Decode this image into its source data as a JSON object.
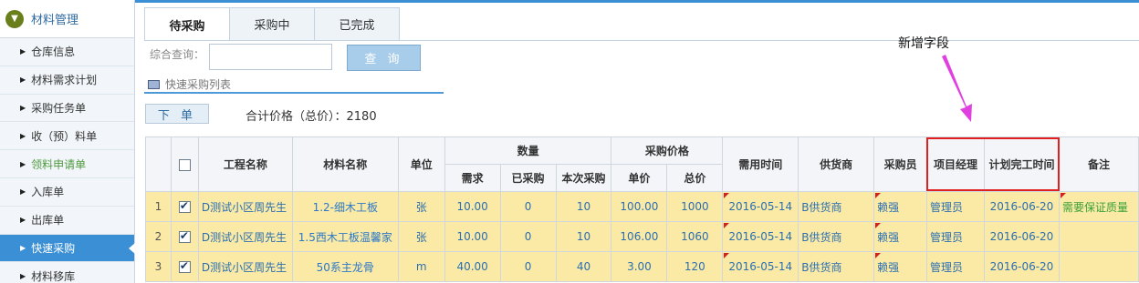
{
  "sidebar": {
    "header": "材料管理",
    "items": [
      {
        "label": "仓库信息",
        "state": "normal"
      },
      {
        "label": "材料需求计划",
        "state": "normal"
      },
      {
        "label": "采购任务单",
        "state": "normal"
      },
      {
        "label": "收（预）料单",
        "state": "normal"
      },
      {
        "label": "领料申请单",
        "state": "green"
      },
      {
        "label": "入库单",
        "state": "normal"
      },
      {
        "label": "出库单",
        "state": "normal"
      },
      {
        "label": "快速采购",
        "state": "active"
      },
      {
        "label": "材料移库",
        "state": "normal"
      }
    ]
  },
  "tabs": [
    "待采购",
    "采购中",
    "已完成"
  ],
  "search": {
    "label": "综合查询：",
    "value": "",
    "button": "查 询"
  },
  "list_title": "快速采购列表",
  "order_button": "下 单",
  "total_text": "合计价格（总价）：2180",
  "annotation": {
    "text": "新增字段",
    "color": "#e040e0",
    "box_color": "#e02020"
  },
  "table": {
    "headers": {
      "project": "工程名称",
      "material": "材料名称",
      "unit": "单位",
      "quantity_group": "数量",
      "qty_demand": "需求",
      "qty_bought": "已采购",
      "qty_this": "本次采购",
      "price_group": "采购价格",
      "unit_price": "单价",
      "total_price": "总价",
      "need_time": "需用时间",
      "supplier": "供货商",
      "buyer": "采购员",
      "pm": "项目经理",
      "plan_finish": "计划完工时间",
      "remark": "备注"
    },
    "rows": [
      {
        "idx": "1",
        "checked": true,
        "project": "D测试小区周先生",
        "material": "1.2-细木工板",
        "unit": "张",
        "demand": "10.00",
        "bought": "0",
        "this": "10",
        "price": "100.00",
        "total": "1000",
        "need_time": "2016-05-14",
        "supplier": "B供货商",
        "buyer": "赖强",
        "pm": "管理员",
        "plan": "2016-06-20",
        "remark": "需要保证质量"
      },
      {
        "idx": "2",
        "checked": true,
        "project": "D测试小区周先生",
        "material": "1.5西木工板温馨家",
        "unit": "张",
        "demand": "10.00",
        "bought": "0",
        "this": "10",
        "price": "106.00",
        "total": "1060",
        "need_time": "2016-05-14",
        "supplier": "B供货商",
        "buyer": "赖强",
        "pm": "管理员",
        "plan": "2016-06-20",
        "remark": ""
      },
      {
        "idx": "3",
        "checked": true,
        "project": "D测试小区周先生",
        "material": "50系主龙骨",
        "unit": "m",
        "demand": "40.00",
        "bought": "0",
        "this": "40",
        "price": "3.00",
        "total": "120",
        "need_time": "2016-05-14",
        "supplier": "B供货商",
        "buyer": "赖强",
        "pm": "管理员",
        "plan": "2016-06-20",
        "remark": ""
      }
    ]
  }
}
